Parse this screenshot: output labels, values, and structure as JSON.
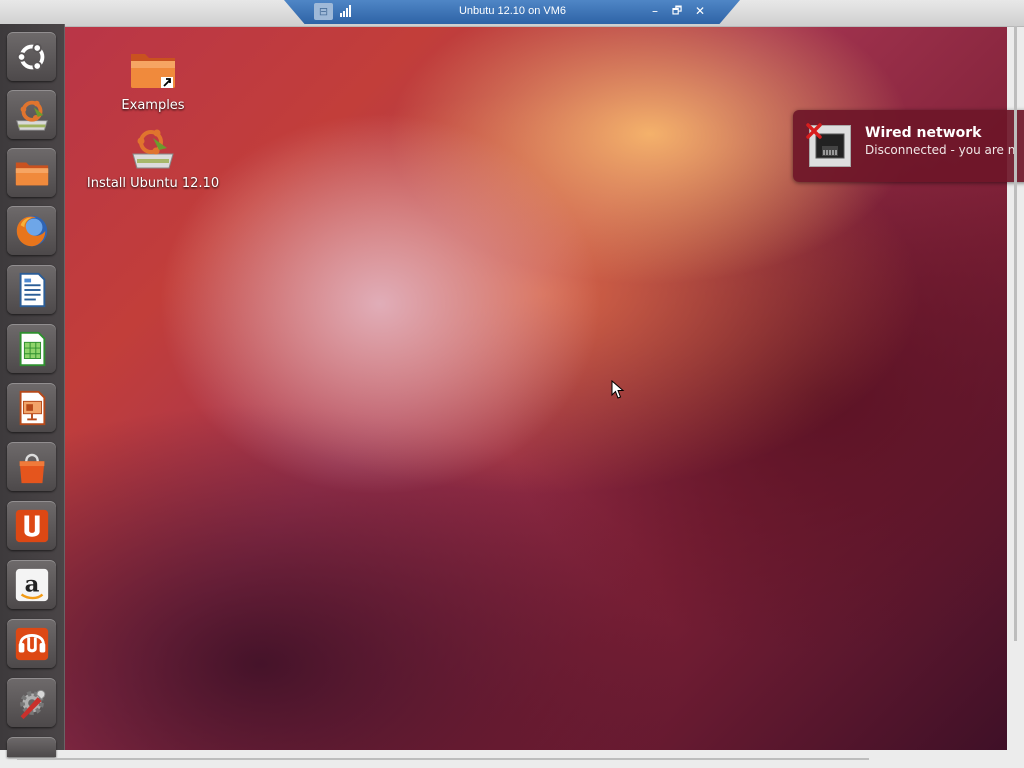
{
  "vm_window": {
    "title": "Unbutu 12.10 on VM6",
    "minimize_label": "–",
    "restore_label": "🗗",
    "close_label": "✕"
  },
  "launcher": {
    "items": [
      {
        "name": "dash-home",
        "icon": "ubuntu-logo-icon"
      },
      {
        "name": "install-ubuntu",
        "icon": "installer-icon"
      },
      {
        "name": "files",
        "icon": "folder-icon"
      },
      {
        "name": "firefox",
        "icon": "firefox-icon"
      },
      {
        "name": "libreoffice-writer",
        "icon": "writer-icon"
      },
      {
        "name": "libreoffice-calc",
        "icon": "calc-icon"
      },
      {
        "name": "libreoffice-impress",
        "icon": "impress-icon"
      },
      {
        "name": "software-center",
        "icon": "shopping-bag-icon"
      },
      {
        "name": "ubuntu-one",
        "icon": "ubuntu-one-icon"
      },
      {
        "name": "amazon",
        "icon": "amazon-icon"
      },
      {
        "name": "ubuntu-one-music",
        "icon": "ubuntu-one-music-icon"
      },
      {
        "name": "system-settings",
        "icon": "settings-icon"
      }
    ]
  },
  "desktop": {
    "icons": [
      {
        "label": "Examples",
        "icon": "folder-link-icon"
      },
      {
        "label": "Install Ubuntu 12.10",
        "icon": "installer-icon"
      }
    ]
  },
  "notification": {
    "title": "Wired network",
    "body": "Disconnected - you are n",
    "icon": "network-disconnected-icon"
  },
  "colors": {
    "vm_bar_blue": "#2e63a6",
    "launcher_bg": "#3d3a3c",
    "notification_bg": "#6e1628",
    "ubuntu_orange": "#dd4814"
  }
}
